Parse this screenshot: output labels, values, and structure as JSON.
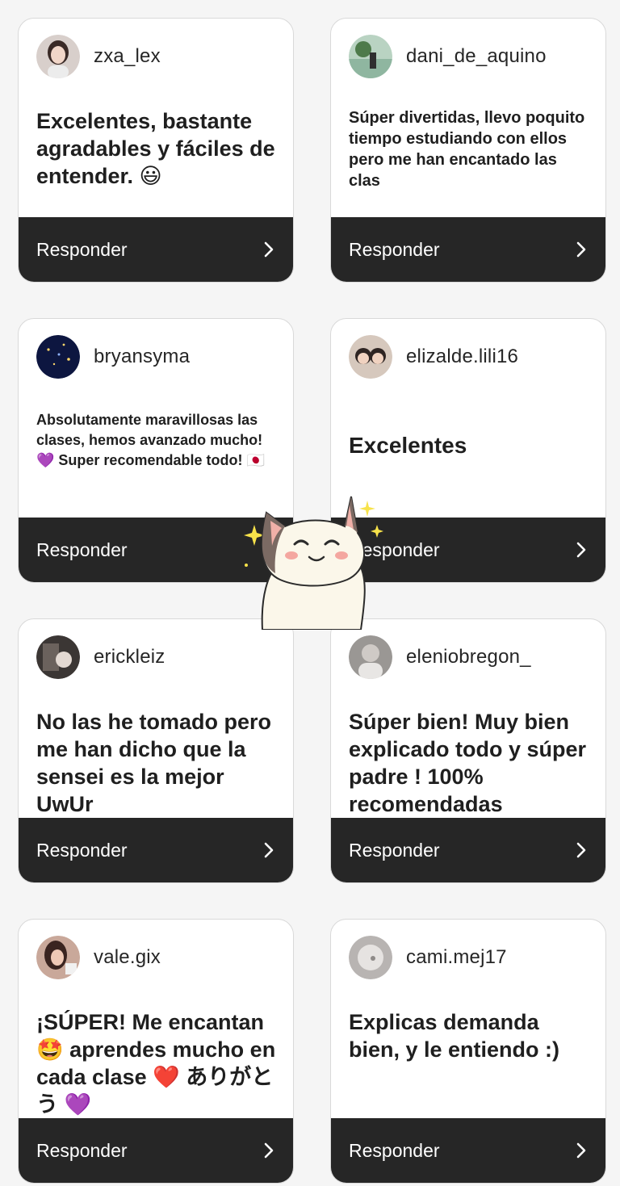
{
  "reply_label": "Responder",
  "colors": {
    "page_bg": "#f5f5f5",
    "card_bg": "#ffffff",
    "footer_bg": "#262626",
    "reply_text": "#ffffff"
  },
  "comments": [
    {
      "username": "zxa_lex",
      "text": "Excelentes, bastante agradables y fáciles de entender. 😃",
      "avatar_icon": "girl-selfie-avatar"
    },
    {
      "username": "dani_de_aquino",
      "text": "Súper divertidas, llevo poquito tiempo estudiando con ellos pero me han encantado las clas",
      "avatar_icon": "beach-photo-avatar"
    },
    {
      "username": "bryansyma",
      "text": "Absolutamente maravillosas las clases, hemos avanzado mucho! 💜 Super recomendable todo! 🇯🇵",
      "avatar_icon": "night-sky-avatar"
    },
    {
      "username": "elizalde.lili16",
      "text": "Excelentes",
      "avatar_icon": "couple-photo-avatar"
    },
    {
      "username": "erickleiz",
      "text": "No las he tomado pero me han dicho que la sensei es la mejor UwUr",
      "avatar_icon": "dark-photo-avatar"
    },
    {
      "username": "eleniobregon_",
      "text": "Súper bien! Muy bien explicado todo y súper padre ! 100% recomendadas",
      "avatar_icon": "grey-photo-avatar"
    },
    {
      "username": "vale.gix",
      "text": "¡SÚPER! Me encantan 🤩 aprendes mucho en cada clase ❤️ ありがとう 💜",
      "avatar_icon": "girl-portrait-avatar"
    },
    {
      "username": "cami.mej17",
      "text": "Explicas demanda bien, y le entiendo :)",
      "avatar_icon": "blurred-photo-avatar"
    }
  ],
  "sticker": "smiling-cat-sticker"
}
